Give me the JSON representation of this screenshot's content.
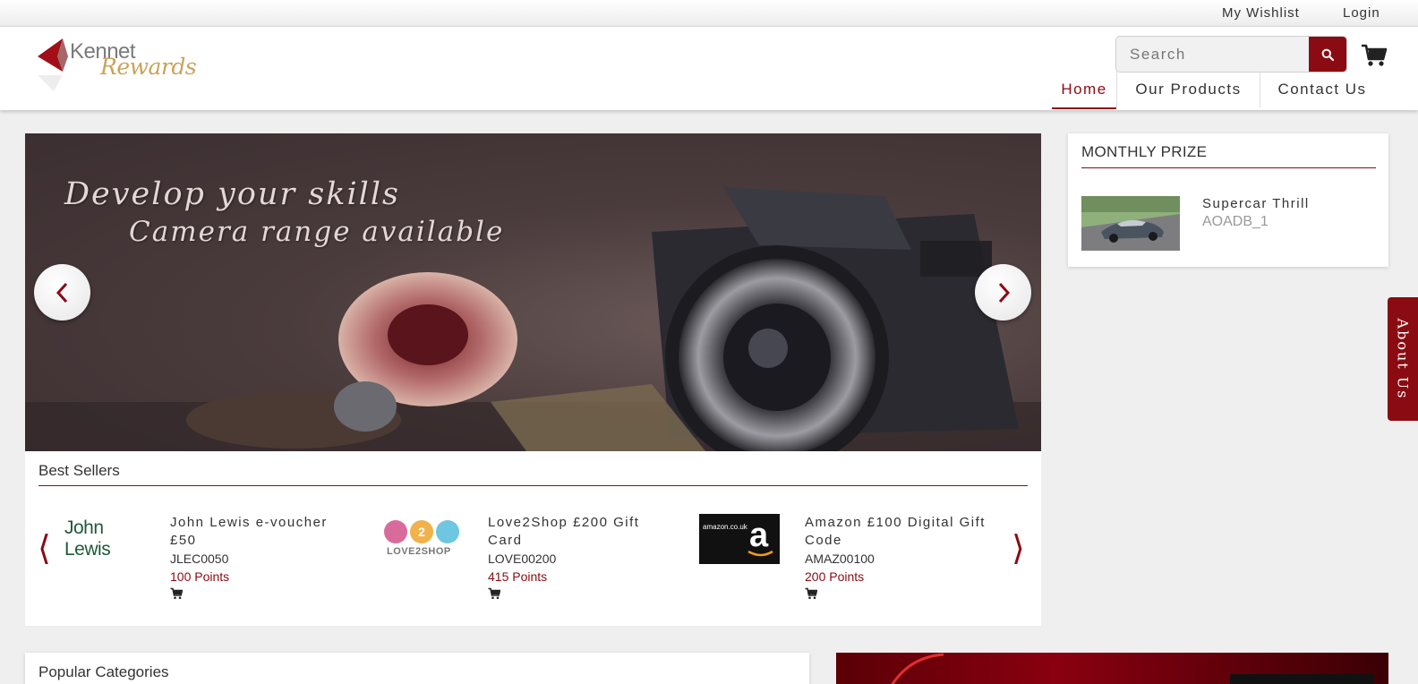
{
  "topbar": {
    "wishlist": "My Wishlist",
    "login": "Login"
  },
  "brand": {
    "line1": "Kennet",
    "line2": "Rewards"
  },
  "search": {
    "placeholder": "Search"
  },
  "nav": {
    "items": [
      {
        "label": "Home",
        "active": true
      },
      {
        "label": "Our Products"
      },
      {
        "label": "Contact Us"
      }
    ]
  },
  "hero": {
    "line1": "Develop your skills",
    "line2": "Camera range available"
  },
  "best_sellers": {
    "title": "Best Sellers",
    "products": [
      {
        "name": "John Lewis e-voucher £50",
        "code": "JLEC0050",
        "points": "100 Points",
        "logo_text": "John Lewis"
      },
      {
        "name": "Love2Shop £200 Gift Card",
        "code": "LOVE00200",
        "points": "415 Points",
        "logo_text": "LOVE2SHOP"
      },
      {
        "name": "Amazon £100 Digital Gift Code",
        "code": "AMAZ00100",
        "points": "200 Points",
        "logo_text": "amazon.co.uk"
      }
    ]
  },
  "monthly_prize": {
    "title": "MONTHLY PRIZE",
    "name": "Supercar Thrill",
    "code": "AOADB_1"
  },
  "about_tab": "About Us",
  "popular": {
    "title": "Popular Categories"
  },
  "colors": {
    "brand": "#8b0b12",
    "gold": "#c9a35a"
  }
}
